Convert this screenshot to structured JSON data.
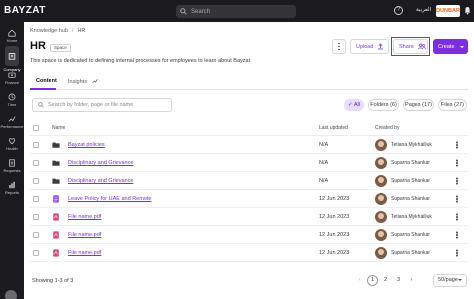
{
  "topbar": {
    "logo": "BAYZAT",
    "search_placeholder": "Search",
    "help": "?",
    "language": "العربية",
    "company": "DUNBAR"
  },
  "sidebar": {
    "items": [
      {
        "label": "Home",
        "icon": "home-icon"
      },
      {
        "label": "Company",
        "icon": "company-icon",
        "active": true
      },
      {
        "label": "Finance",
        "icon": "finance-icon"
      },
      {
        "label": "Time",
        "icon": "time-icon"
      },
      {
        "label": "Performance",
        "icon": "performance-icon"
      },
      {
        "label": "Health",
        "icon": "health-icon"
      },
      {
        "label": "Requests",
        "icon": "requests-icon"
      },
      {
        "label": "Reports",
        "icon": "reports-icon"
      }
    ]
  },
  "breadcrumb": {
    "parent": "Knowledge hub",
    "separator": "/",
    "current": "HR"
  },
  "page": {
    "title": "HR",
    "badge": "Space",
    "description": "This space is dedicated to defining internal processes for employees to learn about Bayzat"
  },
  "actions": {
    "upload": "Upload",
    "share": "Share",
    "create": "Create"
  },
  "tabs": [
    {
      "label": "Content"
    },
    {
      "label": "Insights"
    }
  ],
  "file_search_placeholder": "Search by folder, page or file name",
  "filters": {
    "all": "All",
    "folders": "Folders (6)",
    "pages": "Pages (17)",
    "files": "Files (27)"
  },
  "table": {
    "headers": {
      "name": "Name",
      "updated": "Last updated",
      "by": "Created by"
    },
    "rows": [
      {
        "type": "folder",
        "name": "Bayzat policies",
        "updated": "N/A",
        "by": "Tetiana Mykhailiuk"
      },
      {
        "type": "folder",
        "name": "Disciplinary and Grievance",
        "updated": "N/A",
        "by": "Suparna Shankar"
      },
      {
        "type": "folder",
        "name": "Disciplinary and Grievance",
        "updated": "N/A",
        "by": "Suparna Shankar"
      },
      {
        "type": "page",
        "name": "Leave Policy for UAE and Remote",
        "updated": "12 Jun 2023",
        "by": "Suparna Shankar"
      },
      {
        "type": "pdf",
        "name": "File name.pdf",
        "updated": "12 Jun 2023",
        "by": "Tetiana Mykhailiuk"
      },
      {
        "type": "pdf",
        "name": "File name.pdf",
        "updated": "12 Jun 2023",
        "by": "Suparna Shankar"
      },
      {
        "type": "pdf",
        "name": "File name.pdf",
        "updated": "12 Jun 2023",
        "by": "Suparna Shankar"
      }
    ]
  },
  "footer": {
    "showing": "Showing 1-3 of 3",
    "pages": [
      "1",
      "2",
      "3"
    ],
    "per_page": "50/page"
  },
  "colors": {
    "accent": "#7d2ee0",
    "topbar": "#1b1b1f",
    "highlight": "#e02020"
  }
}
